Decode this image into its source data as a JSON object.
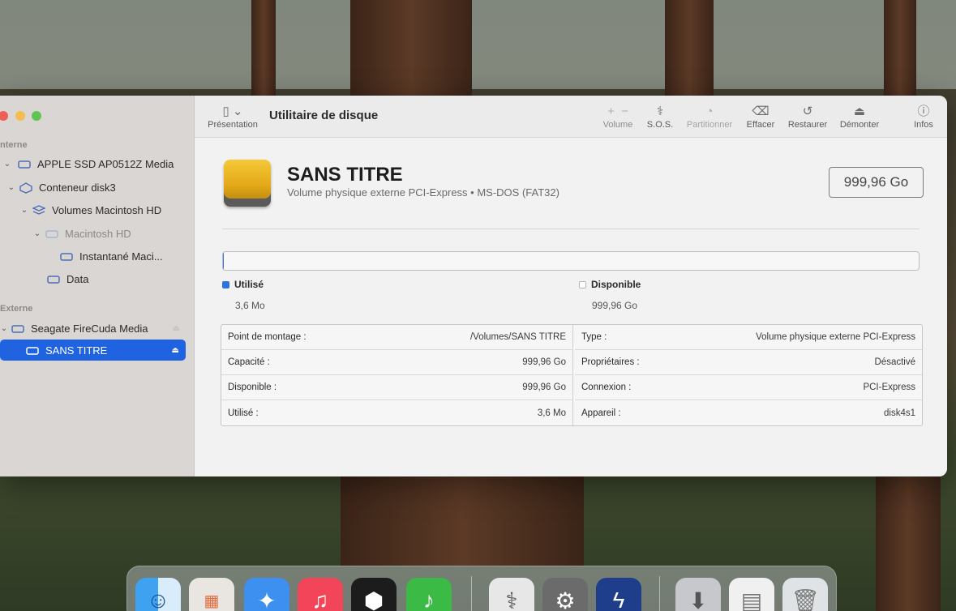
{
  "window": {
    "title": "Utilitaire de disque",
    "presentation_label": "Présentation"
  },
  "sidebar": {
    "section_internal": "nterne",
    "section_external": "Externe",
    "items": [
      {
        "label": "APPLE SSD AP0512Z Media"
      },
      {
        "label": "Conteneur disk3"
      },
      {
        "label": "Volumes Macintosh HD"
      },
      {
        "label": "Macintosh HD"
      },
      {
        "label": "Instantané Maci..."
      },
      {
        "label": "Data"
      },
      {
        "label": "Seagate FireCuda Media"
      },
      {
        "label": "SANS TITRE"
      }
    ]
  },
  "toolbar": {
    "add_symbol": "+",
    "remove_symbol": "−",
    "volume": "Volume",
    "sos": "S.O.S.",
    "partition": "Partitionner",
    "erase": "Effacer",
    "restore": "Restaurer",
    "unmount": "Démonter",
    "info": "Infos"
  },
  "volume": {
    "name": "SANS TITRE",
    "subtitle": "Volume physique externe PCI-Express • MS-DOS (FAT32)",
    "capacity_badge": "999,96 Go",
    "used_fraction": 3.6e-06
  },
  "legend": {
    "used_label": "Utilisé",
    "used_value": "3,6 Mo",
    "available_label": "Disponible",
    "available_value": "999,96 Go"
  },
  "info": {
    "left": [
      {
        "k": "Point de montage :",
        "v": "/Volumes/SANS TITRE"
      },
      {
        "k": "Capacité :",
        "v": "999,96 Go"
      },
      {
        "k": "Disponible :",
        "v": "999,96 Go"
      },
      {
        "k": "Utilisé :",
        "v": "3,6 Mo"
      }
    ],
    "right": [
      {
        "k": "Type :",
        "v": "Volume physique externe PCI-Express"
      },
      {
        "k": "Propriétaires :",
        "v": "Désactivé"
      },
      {
        "k": "Connexion :",
        "v": "PCI-Express"
      },
      {
        "k": "Appareil :",
        "v": "disk4s1"
      }
    ]
  },
  "colors": {
    "selection": "#1f63e0",
    "used": "#2d74dd",
    "drive_icon": "#e3a918"
  },
  "dock": {
    "icons": [
      "finder-icon",
      "launchpad-icon",
      "safari-icon",
      "music-icon",
      "blackmagic-icon",
      "itunes-icon",
      "disk-utility-icon",
      "system-settings-icon",
      "transfer-icon",
      "downloads-icon",
      "document-icon",
      "trash-icon"
    ]
  }
}
